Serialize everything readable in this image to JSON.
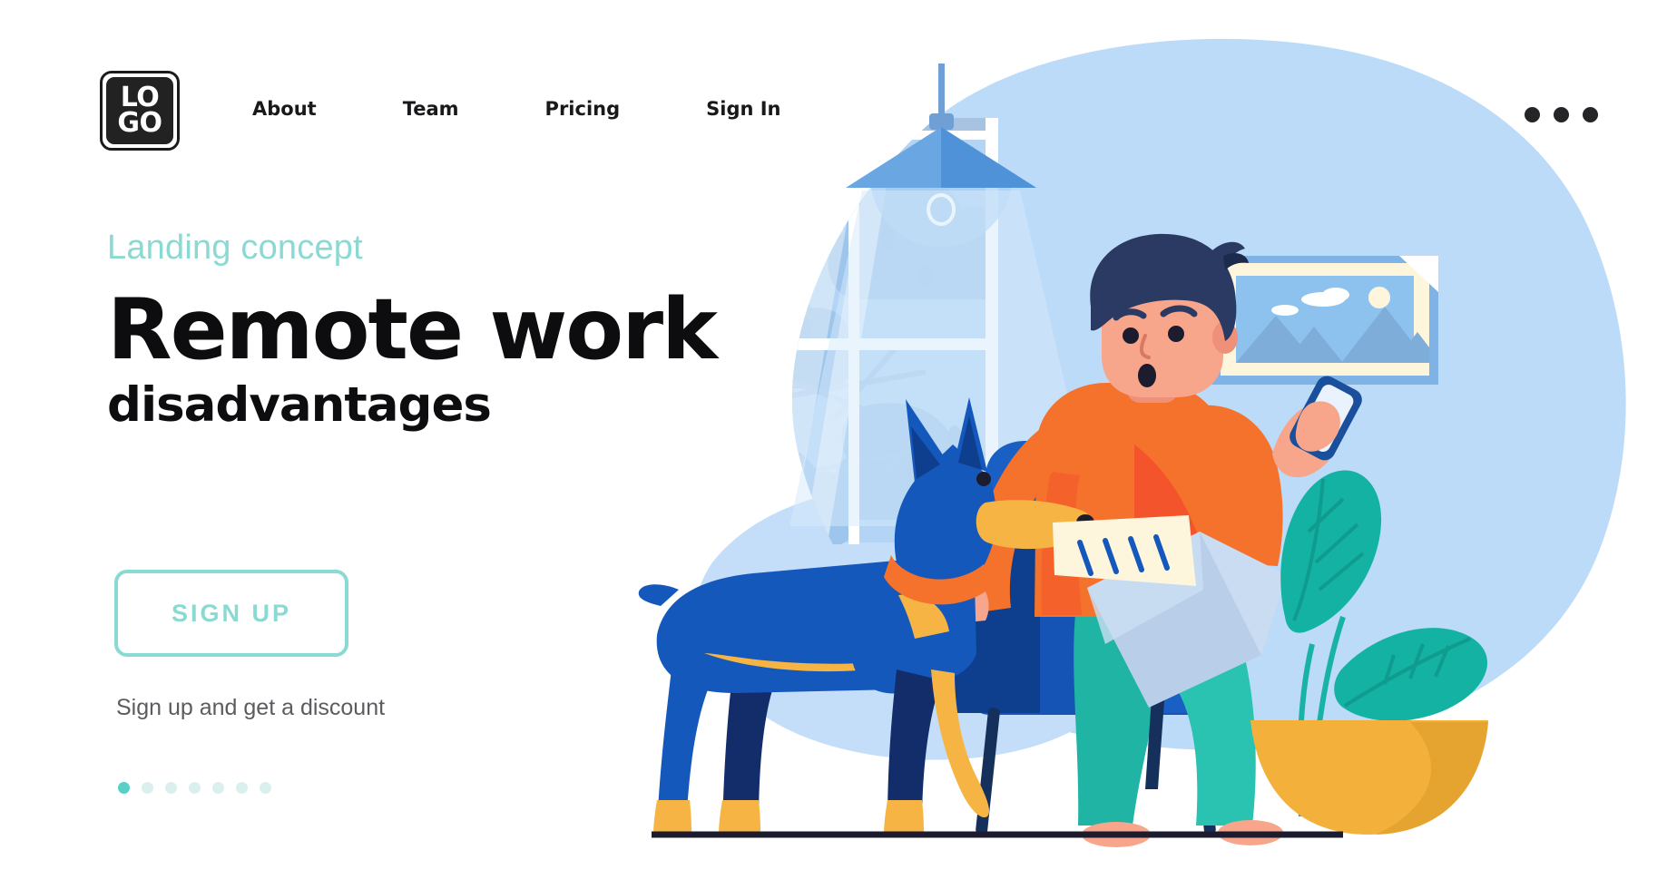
{
  "header": {
    "logo": {
      "line1": "LO",
      "line2": "GO",
      "alt": "LOGO"
    },
    "nav": [
      {
        "label": "About"
      },
      {
        "label": "Team"
      },
      {
        "label": "Pricing"
      },
      {
        "label": "Sign In"
      }
    ],
    "menu_icon": "more-horizontal-icon"
  },
  "hero": {
    "eyebrow": "Landing concept",
    "title": "Remote work",
    "subtitle": "disadvantages",
    "cta_label": "SIGN UP",
    "cta_note": "Sign up and get a discount",
    "carousel": {
      "count": 7,
      "active_index": 0
    }
  },
  "colors": {
    "accent_teal": "#8bd9d3",
    "accent_teal_strong": "#59cfc6",
    "text_dark": "#0d0d0f",
    "text_muted": "#5b5b60",
    "blob_blue": "#b9d9f7",
    "blob_blue_light": "#cfe5fb",
    "sweater_orange": "#f4722b",
    "sweater_orange_dark": "#f4542b",
    "pants_teal": "#2ac2b0",
    "chair_blue": "#1a5fc4",
    "chair_blue_dark": "#0e3f8f",
    "hair_navy": "#2b3a63",
    "skin": "#f7a58b",
    "dog_blue": "#1558bc",
    "dog_yellow": "#f6b445",
    "pot_yellow": "#f3b13c",
    "plant_teal": "#18b3a6",
    "laptop_blue": "#b9cfe9",
    "floor_line": "#1c1c2e"
  },
  "illustration": {
    "scene_name": "man-working-remotely-in-armchair-with-dog",
    "elements": [
      "background-blob",
      "window-with-curtain",
      "tree-outside-window",
      "pendant-lamp",
      "framed-mountain-picture",
      "man-with-phone",
      "armchair",
      "laptop",
      "doberman-dog-with-paper",
      "potted-plant",
      "floor-line"
    ]
  }
}
